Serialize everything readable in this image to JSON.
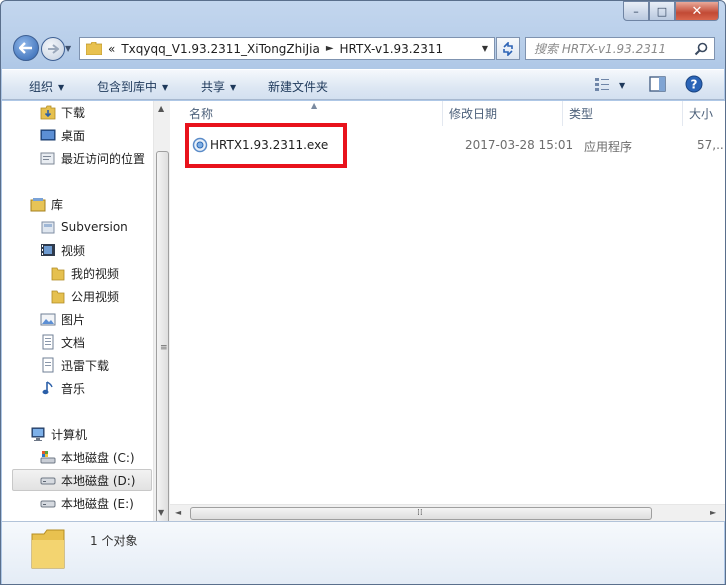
{
  "window": {
    "caption_min": "–",
    "caption_max": "□",
    "caption_close": "✕"
  },
  "address": {
    "overflow": "«",
    "crumbs": [
      "Txqyqq_V1.93.2311_XiTongZhiJia",
      "HRTX-v1.93.2311"
    ],
    "separator": "►"
  },
  "search": {
    "placeholder": "搜索 HRTX-v1.93.2311"
  },
  "toolbar": {
    "organize": "组织",
    "include_library": "包含到库中",
    "share": "共享",
    "new_folder": "新建文件夹"
  },
  "nav": {
    "downloads": "下载",
    "desktop": "桌面",
    "recent": "最近访问的位置",
    "libraries": "库",
    "subversion": "Subversion",
    "videos": "视频",
    "my_videos": "我的视频",
    "public_videos": "公用视频",
    "pictures": "图片",
    "documents": "文档",
    "thunder": "迅雷下载",
    "music": "音乐",
    "computer": "计算机",
    "drive_c": "本地磁盘 (C:)",
    "drive_d": "本地磁盘 (D:)",
    "drive_e": "本地磁盘 (E:)"
  },
  "columns": {
    "name": "名称",
    "modified": "修改日期",
    "type": "类型",
    "size": "大小"
  },
  "files": [
    {
      "name": "HRTX1.93.2311.exe",
      "modified": "2017-03-28 15:01",
      "type": "应用程序",
      "size": "57,..."
    }
  ],
  "details": {
    "count": "1 个对象"
  },
  "colors": {
    "highlight": "#e8121c",
    "chrome": "#b9cfea"
  },
  "icons": {
    "back": "back-arrow-icon",
    "forward": "forward-arrow-icon",
    "refresh": "refresh-icon",
    "search": "search-icon",
    "views": "views-icon",
    "preview": "preview-pane-icon",
    "help": "help-icon"
  }
}
